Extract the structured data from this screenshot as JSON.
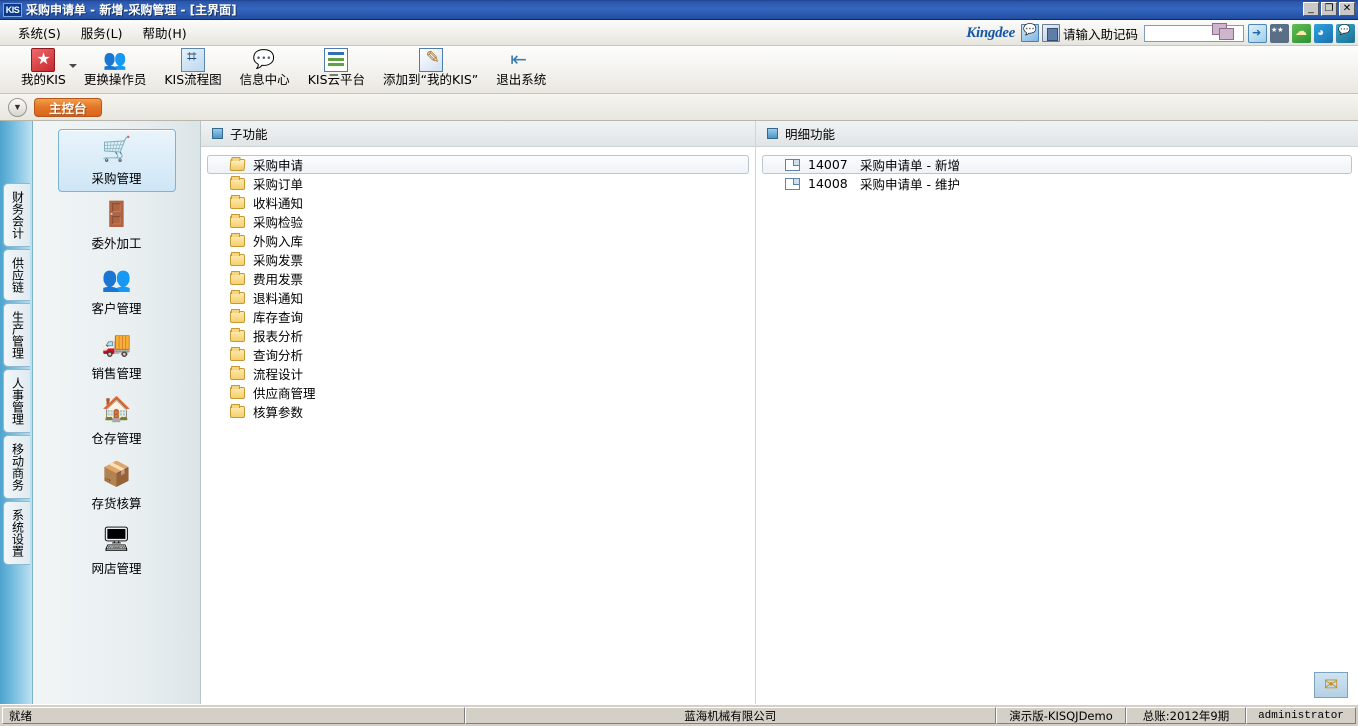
{
  "window": {
    "title": "采购申请单 - 新增-采购管理 - [主界面]",
    "logo": "KIS",
    "minimize": "_",
    "maximize": "❐",
    "close": "✕"
  },
  "menubar": {
    "items": [
      {
        "label": "系统",
        "accel": "(S)"
      },
      {
        "label": "服务",
        "accel": "(L)"
      },
      {
        "label": "帮助",
        "accel": "(H)"
      }
    ],
    "brand": "Kingdee",
    "hint_label": "请输入助记码",
    "hint_value": "",
    "hint_placeholder": ""
  },
  "toolbar": {
    "items": [
      {
        "label": "我的KIS",
        "icon": "star-icon",
        "has_dropdown": true
      },
      {
        "label": "更换操作员",
        "icon": "people-swap-icon",
        "has_dropdown": false
      },
      {
        "label": "KIS流程图",
        "icon": "flowchart-icon",
        "has_dropdown": false
      },
      {
        "label": "信息中心",
        "icon": "message-icon",
        "has_dropdown": false
      },
      {
        "label": "KIS云平台",
        "icon": "list-icon",
        "has_dropdown": false
      },
      {
        "label": "添加到“我的KIS”",
        "icon": "edit-icon",
        "has_dropdown": false
      },
      {
        "label": "退出系统",
        "icon": "exit-icon",
        "has_dropdown": false
      }
    ]
  },
  "tabstrip": {
    "dropdown_glyph": "▼",
    "active_tab": "主控台"
  },
  "rail": {
    "items": [
      "财务会计",
      "供应链",
      "生产管理",
      "人事管理",
      "移动商务",
      "系统设置"
    ],
    "active_index": 1
  },
  "modules": {
    "items": [
      {
        "label": "采购管理",
        "icon": "purchase-icon",
        "glyph": "🛒",
        "selected": true
      },
      {
        "label": "委外加工",
        "icon": "outsourcing-icon",
        "glyph": "🚪",
        "selected": false
      },
      {
        "label": "客户管理",
        "icon": "customer-icon",
        "glyph": "👥",
        "selected": false
      },
      {
        "label": "销售管理",
        "icon": "sales-truck-icon",
        "glyph": "🚚",
        "selected": false
      },
      {
        "label": "仓存管理",
        "icon": "warehouse-icon",
        "glyph": "🏠",
        "selected": false
      },
      {
        "label": "存货核算",
        "icon": "inventory-accounting-icon",
        "glyph": "📦",
        "selected": false
      },
      {
        "label": "网店管理",
        "icon": "online-store-icon",
        "glyph": "🖥",
        "selected": false
      }
    ]
  },
  "sub_functions": {
    "header": "子功能",
    "items": [
      {
        "label": "采购申请",
        "selected": true
      },
      {
        "label": "采购订单",
        "selected": false
      },
      {
        "label": "收料通知",
        "selected": false
      },
      {
        "label": "采购检验",
        "selected": false
      },
      {
        "label": "外购入库",
        "selected": false
      },
      {
        "label": "采购发票",
        "selected": false
      },
      {
        "label": "费用发票",
        "selected": false
      },
      {
        "label": "退料通知",
        "selected": false
      },
      {
        "label": "库存查询",
        "selected": false
      },
      {
        "label": "报表分析",
        "selected": false
      },
      {
        "label": "查询分析",
        "selected": false
      },
      {
        "label": "流程设计",
        "selected": false
      },
      {
        "label": "供应商管理",
        "selected": false
      },
      {
        "label": "核算参数",
        "selected": false
      }
    ]
  },
  "detail_functions": {
    "header": "明细功能",
    "items": [
      {
        "code": "14007",
        "label": "采购申请单 - 新增",
        "selected": true
      },
      {
        "code": "14008",
        "label": "采购申请单 - 维护",
        "selected": false
      }
    ]
  },
  "statusbar": {
    "state": "就绪",
    "company": "蓝海机械有限公司",
    "edition": "演示版-KISQJDemo",
    "period": "总账:2012年9期",
    "user": "administrator"
  },
  "misc": {
    "mail_icon": "mail-icon"
  },
  "colors": {
    "titlebar": "#2a57ab",
    "accent_tab": "#e4772a",
    "rail": "#69b6dc",
    "brand": "#1556a5"
  }
}
